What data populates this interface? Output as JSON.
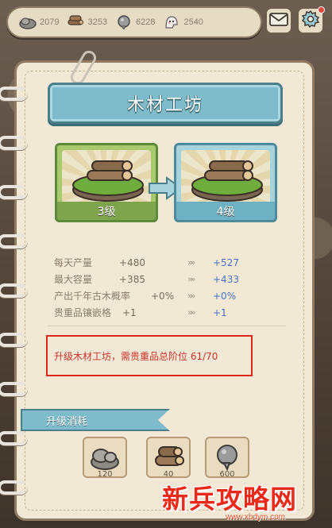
{
  "resources": [
    {
      "icon": "stone-icon",
      "value": "2079"
    },
    {
      "icon": "wood-icon",
      "value": "3253"
    },
    {
      "icon": "spirit-stone-icon",
      "value": "6228"
    },
    {
      "icon": "ghost-icon",
      "value": "2540"
    }
  ],
  "topbar_buttons": {
    "mail": "mail-icon",
    "settings": "gear-icon"
  },
  "building": {
    "title": "木材工坊",
    "current_level": "3级",
    "next_level": "4级"
  },
  "stats": [
    {
      "name": "每天产量",
      "current": "+480",
      "next": "+527"
    },
    {
      "name": "最大容量",
      "current": "+385",
      "next": "+433"
    },
    {
      "name": "产出千年古木概率",
      "current": "+0%",
      "next": "+0%"
    },
    {
      "name": "贵重品镶嵌格",
      "current": "+1",
      "next": "+1"
    }
  ],
  "stat_arrow": "»»",
  "requirement": "升级木材工坊，需贵重品总阶位 61/70",
  "upgrade_cost": {
    "title": "升级消耗",
    "items": [
      {
        "icon": "stone-icon",
        "value": "120"
      },
      {
        "icon": "wood-icon",
        "value": "40"
      },
      {
        "icon": "spirit-stone-icon",
        "value": "600"
      }
    ]
  },
  "watermark": {
    "text": "新兵攻略网",
    "url": "www.xbdym.com"
  },
  "colors": {
    "accent": "#7fbccb",
    "next_value": "#4a73c4",
    "warning": "#c9332a"
  }
}
